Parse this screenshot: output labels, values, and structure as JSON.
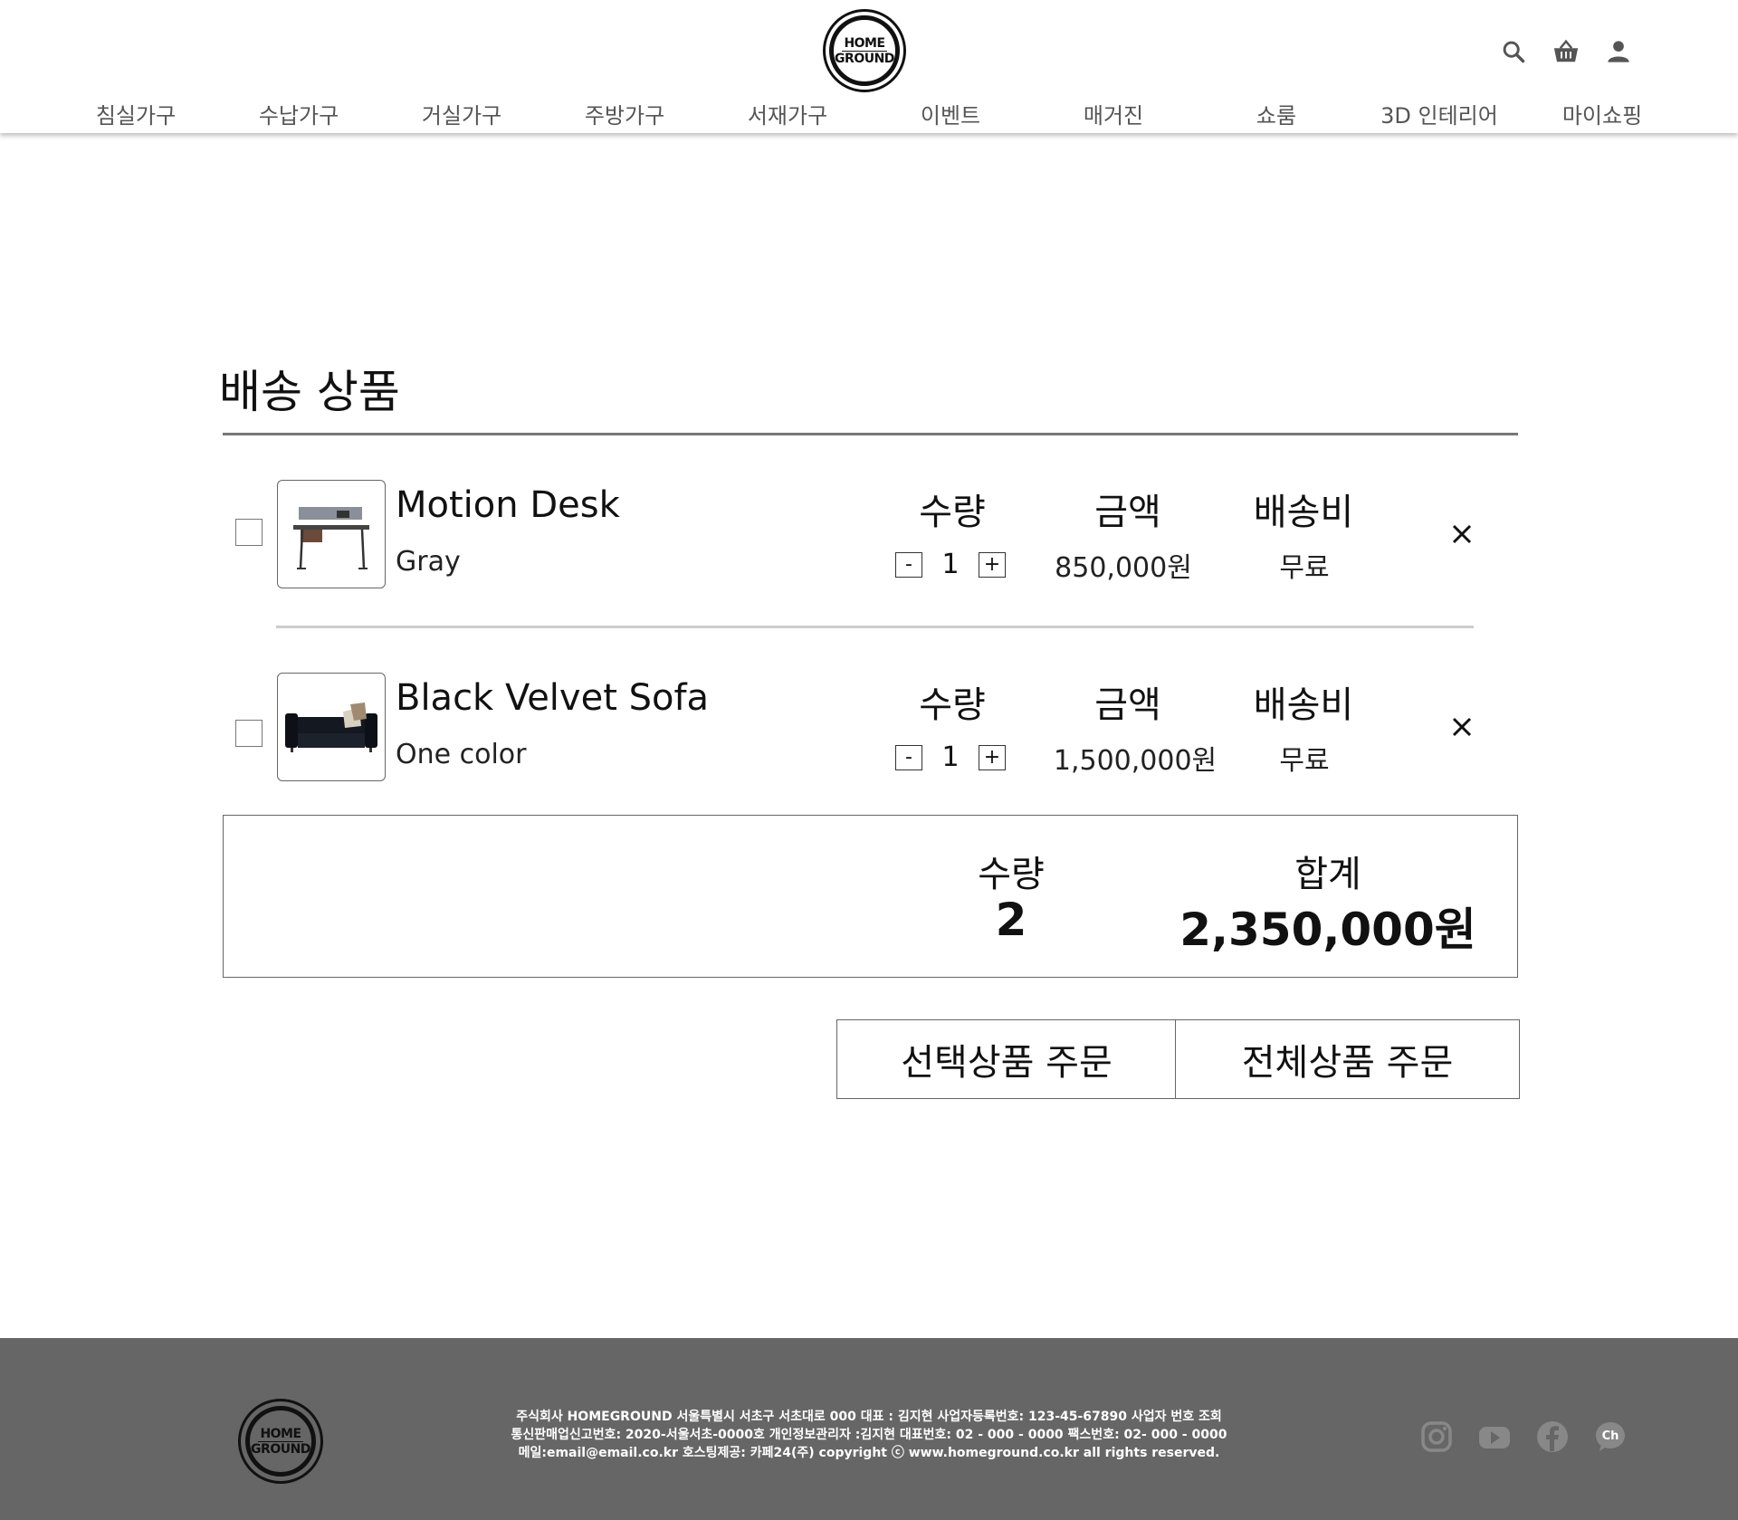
{
  "header": {
    "logo_line1": "HOME",
    "logo_line2": "GROUND",
    "icons": [
      "search-icon",
      "cart-icon",
      "user-icon"
    ],
    "nav": [
      {
        "label": "침실가구"
      },
      {
        "label": "수납가구"
      },
      {
        "label": "거실가구"
      },
      {
        "label": "주방가구"
      },
      {
        "label": "서재가구"
      },
      {
        "label": "이벤트"
      },
      {
        "label": "매거진"
      },
      {
        "label": "쇼룸"
      },
      {
        "label": "3D 인테리어"
      },
      {
        "label": "마이쇼핑"
      }
    ]
  },
  "main": {
    "title": "배송 상품",
    "column_labels": {
      "qty": "수량",
      "price": "금액",
      "shipping": "배송비"
    },
    "items": [
      {
        "name": "Motion Desk",
        "option": "Gray",
        "qty": "1",
        "price": "850,000원",
        "shipping": "무료",
        "minus": "-",
        "plus": "+",
        "checked": false
      },
      {
        "name": "Black Velvet Sofa",
        "option": "One color",
        "qty": "1",
        "price": "1,500,000원",
        "shipping": "무료",
        "minus": "-",
        "plus": "+",
        "checked": false
      }
    ],
    "summary": {
      "qty_label": "수량",
      "qty_value": "2",
      "total_label": "합계",
      "total_value": "2,350,000원"
    },
    "buttons": {
      "order_selected": "선택상품 주문",
      "order_all": "전체상품 주문"
    }
  },
  "footer": {
    "logo_line1": "HOME",
    "logo_line2": "GROUND",
    "line1": "주식회사 HOMEGROUND 서울특별시 서초구 서초대로 000 대표 : 김지현 사업자등록번호: 123-45-67890 사업자 번호 조회",
    "line2": "통신판매업신고번호: 2020-서울서초-0000호 개인정보관리자 :김지현 대표번호: 02 - 000 - 0000 팩스번호: 02- 000 - 0000",
    "line3": "메일:email@email.co.kr 호스팅제공: 카페24(주) copyright ⓒ www.homeground.co.kr all rights reserved.",
    "socials": [
      "instagram-icon",
      "youtube-icon",
      "facebook-icon",
      "channel-talk-icon"
    ],
    "chat_label": "Ch"
  },
  "colors": {
    "footer_bg": "#666666",
    "nav_text": "#555555",
    "text": "#111111"
  }
}
